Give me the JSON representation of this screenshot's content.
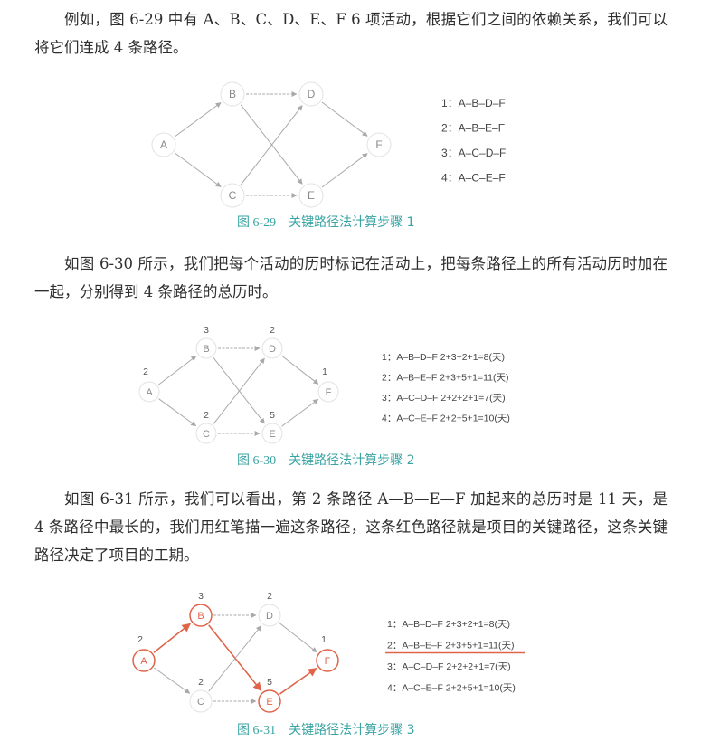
{
  "paragraphs": {
    "p1": "例如，图 6-29 中有 A、B、C、D、E、F 6 项活动，根据它们之间的依赖关系，我们可以将它们连成 4 条路径。",
    "p2": "如图 6-30 所示，我们把每个活动的历时标记在活动上，把每条路径上的所有活动历时加在一起，分别得到 4 条路径的总历时。",
    "p3": "如图 6-31 所示，我们可以看出，第 2 条路径 A—B—E—F 加起来的总历时是 11 天，是 4 条路径中最长的，我们用红笔描一遍这条路径，这条红色路径就是项目的关键路径，这条关键路径决定了项目的工期。"
  },
  "figures": [
    {
      "caption_num": "图 6-29",
      "caption_text": "关键路径法计算步骤 1",
      "nodes": [
        "A",
        "B",
        "C",
        "D",
        "E",
        "F"
      ],
      "durations": {},
      "paths": [
        "1：A–B–D–F",
        "2：A–B–E–F",
        "3：A–C–D–F",
        "4：A–C–E–F"
      ]
    },
    {
      "caption_num": "图 6-30",
      "caption_text": "关键路径法计算步骤 2",
      "nodes": [
        "A",
        "B",
        "C",
        "D",
        "E",
        "F"
      ],
      "durations": {
        "A": "2",
        "B": "3",
        "C": "2",
        "D": "2",
        "E": "5",
        "F": "1"
      },
      "paths": [
        "1：A–B–D–F  2+3+2+1=8(天)",
        "2：A–B–E–F  2+3+5+1=11(天)",
        "3：A–C–D–F  2+2+2+1=7(天)",
        "4：A–C–E–F  2+2+5+1=10(天)"
      ]
    },
    {
      "caption_num": "图 6-31",
      "caption_text": "关键路径法计算步骤 3",
      "nodes": [
        "A",
        "B",
        "C",
        "D",
        "E",
        "F"
      ],
      "durations": {
        "A": "2",
        "B": "3",
        "C": "2",
        "D": "2",
        "E": "5",
        "F": "1"
      },
      "critical_nodes": [
        "A",
        "B",
        "E",
        "F"
      ],
      "critical_path_index": 1,
      "paths": [
        "1：A–B–D–F  2+3+2+1=8(天)",
        "2：A–B–E–F  2+3+5+1=11(天)",
        "3：A–C–D–F  2+2+2+1=7(天)",
        "4：A–C–E–F  2+2+5+1=10(天)"
      ]
    }
  ],
  "colors": {
    "critical": "#e0644a",
    "caption": "#3aa3a3",
    "arrow": "#a9a9a9",
    "node_text": "#8a8a8a"
  }
}
